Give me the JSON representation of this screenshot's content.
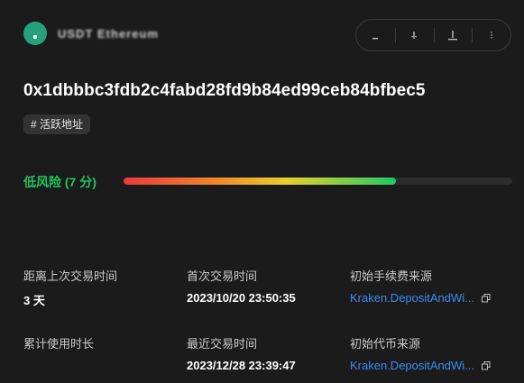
{
  "header": {
    "token_name": "USDT  Ethereum",
    "logo_color": "#26a17b",
    "actions": [
      {
        "name": "minus-icon"
      },
      {
        "name": "share-icon"
      },
      {
        "name": "download-icon"
      },
      {
        "name": "more-icon"
      }
    ]
  },
  "address": "0x1dbbbc3fdb2c4fabd28fd9b84ed99ceb84bfbec5",
  "tag": "# 活跃地址",
  "risk": {
    "label": "低风险 (7 分)",
    "level_fraction": 0.7,
    "label_color": "#1ec65f"
  },
  "info": {
    "days_since_last_tx": {
      "label": "距离上次交易时间",
      "value": "3 天"
    },
    "first_tx_time": {
      "label": "首次交易时间",
      "value": "2023/10/20 23:50:35"
    },
    "initial_fee_source": {
      "label": "初始手续费来源",
      "value": "Kraken.DepositAndWi..."
    },
    "usage_duration": {
      "label": "累计使用时长",
      "value": ""
    },
    "latest_tx_time": {
      "label": "最近交易时间",
      "value": "2023/12/28 23:39:47"
    },
    "initial_token_source": {
      "label": "初始代币来源",
      "value": "Kraken.DepositAndWi..."
    }
  },
  "colors": {
    "background": "#1b1b1b",
    "link": "#3d8bf2"
  }
}
